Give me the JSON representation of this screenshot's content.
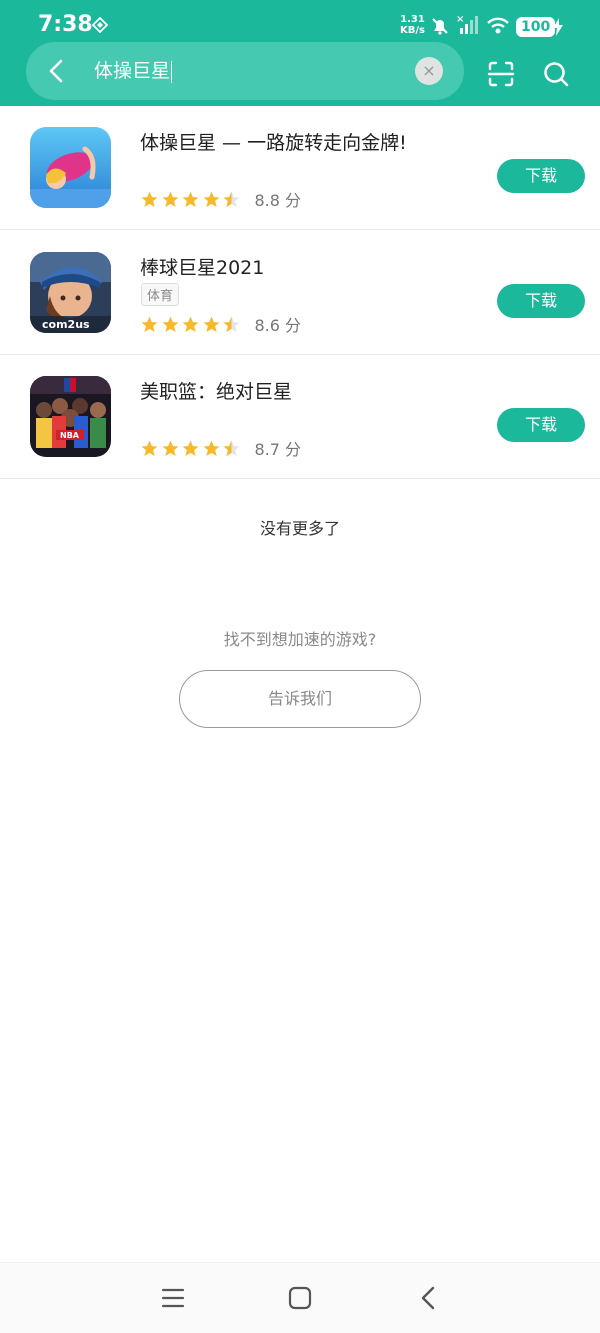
{
  "status": {
    "time": "7:38",
    "net_speed": "1.31",
    "net_unit": "KB/s",
    "battery": "100"
  },
  "search": {
    "query": "体操巨星"
  },
  "results": [
    {
      "title": "体操巨星 — 一路旋转走向金牌!",
      "tag": "",
      "rating": 4.5,
      "score": "8.8 分",
      "button": "下载",
      "icon": "gymnast-game-icon"
    },
    {
      "title": "棒球巨星2021",
      "tag": "体育",
      "rating": 4.5,
      "score": "8.6 分",
      "button": "下载",
      "icon": "baseball-game-icon"
    },
    {
      "title": "美职篮：绝对巨星",
      "tag": "",
      "rating": 4.5,
      "score": "8.7 分",
      "button": "下载",
      "icon": "basketball-game-icon"
    }
  ],
  "footer": {
    "no_more": "没有更多了",
    "hint": "找不到想加速的游戏?",
    "tell_us": "告诉我们"
  },
  "colors": {
    "accent": "#1bb89c",
    "star": "#f7b92a"
  }
}
